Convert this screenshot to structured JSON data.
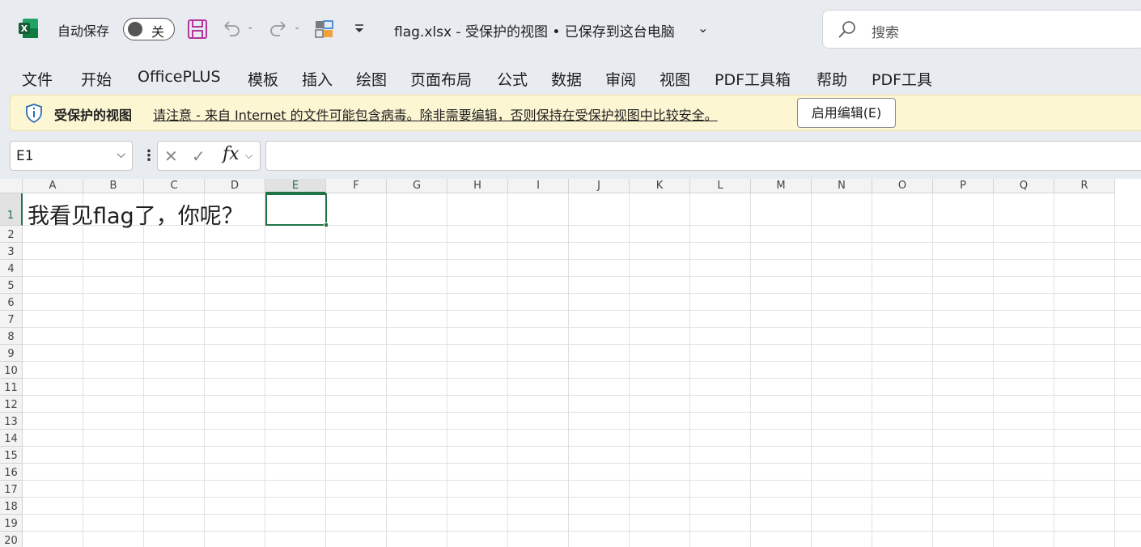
{
  "titlebar": {
    "autosave_label": "自动保存",
    "autosave_state": "关",
    "document_title": "flag.xlsx  -  受保护的视图 • 已保存到这台电脑",
    "search_placeholder": "搜索"
  },
  "ribbon": {
    "tabs": [
      "文件",
      "开始",
      "OfficePLUS",
      "模板",
      "插入",
      "绘图",
      "页面布局",
      "公式",
      "数据",
      "审阅",
      "视图",
      "PDF工具箱",
      "帮助",
      "PDF工具"
    ]
  },
  "protected_view": {
    "title": "受保护的视图",
    "message": "请注意 - 来自 Internet 的文件可能包含病毒。除非需要编辑，否则保持在受保护视图中比较安全。",
    "enable_button": "启用编辑(E)"
  },
  "formula_bar": {
    "name_box": "E1",
    "fx_label": "fx",
    "formula_value": ""
  },
  "sheet": {
    "columns": [
      "A",
      "B",
      "C",
      "D",
      "E",
      "F",
      "G",
      "H",
      "I",
      "J",
      "K",
      "L",
      "M",
      "N",
      "O",
      "P",
      "Q",
      "R"
    ],
    "rows": [
      "1",
      "2",
      "3",
      "4",
      "5",
      "6",
      "7",
      "8",
      "9",
      "10",
      "11",
      "12",
      "13",
      "14",
      "15",
      "16",
      "17",
      "18",
      "19",
      "20"
    ],
    "selected_cell": "E1",
    "cell_a1": "我看见flag了，你呢？"
  },
  "colors": {
    "excel_green": "#217346",
    "protected_bar": "#fdf6d3",
    "save_icon": "#b4359b"
  }
}
